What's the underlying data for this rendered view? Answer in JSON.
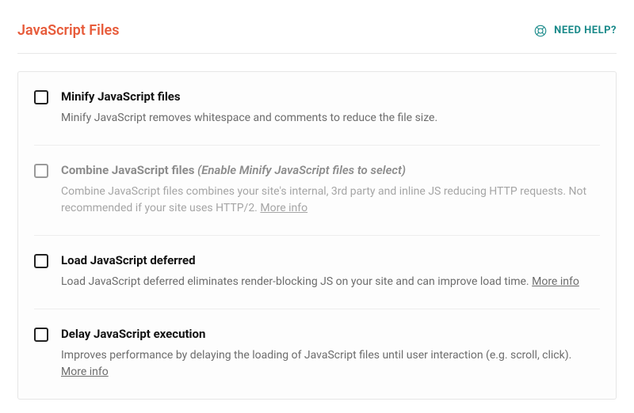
{
  "header": {
    "title": "JavaScript Files",
    "help_label": "NEED HELP?"
  },
  "options": [
    {
      "title": "Minify JavaScript files",
      "note": "",
      "desc": "Minify JavaScript removes whitespace and comments to reduce the file size.",
      "more_info": "",
      "disabled": false
    },
    {
      "title": "Combine JavaScript files",
      "note": "(Enable Minify JavaScript files to select)",
      "desc": "Combine JavaScript files combines your site's internal, 3rd party and inline JS reducing HTTP requests. Not recommended if your site uses HTTP/2.",
      "more_info": "More info",
      "disabled": true
    },
    {
      "title": "Load JavaScript deferred",
      "note": "",
      "desc": "Load JavaScript deferred eliminates render-blocking JS on your site and can improve load time.",
      "more_info": "More info",
      "disabled": false
    },
    {
      "title": "Delay JavaScript execution",
      "note": "",
      "desc": "Improves performance by delaying the loading of JavaScript files until user interaction (e.g. scroll, click).",
      "more_info": "More info",
      "disabled": false
    }
  ]
}
